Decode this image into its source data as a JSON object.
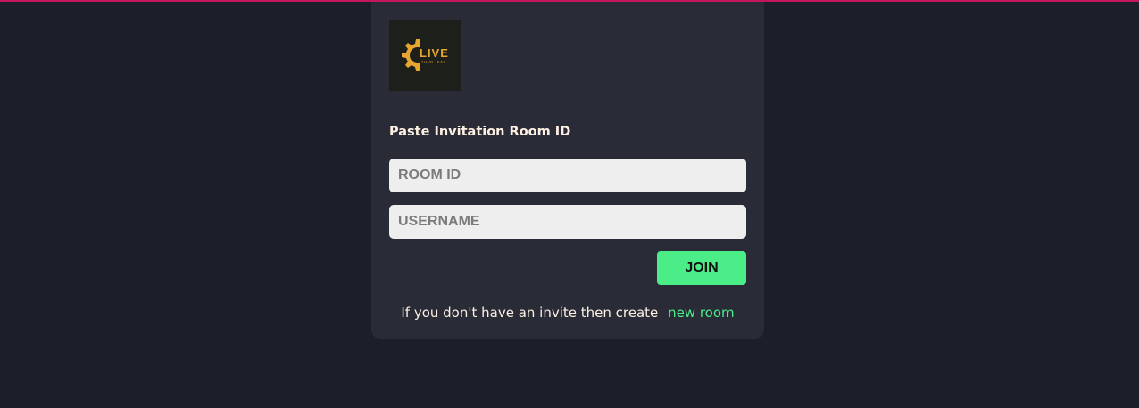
{
  "logo": {
    "text": "LIVE",
    "subtext": "YOUR TEXT",
    "icon": "gear-icon",
    "color": "#e8a530",
    "background": "#1d1f1b"
  },
  "form": {
    "heading": "Paste Invitation Room ID",
    "room_id_placeholder": "ROOM ID",
    "username_placeholder": "USERNAME",
    "join_label": "JOIN"
  },
  "footer": {
    "text": "If you don't have an invite then create",
    "link_label": "new room"
  },
  "colors": {
    "page_background": "#1c1e29",
    "card_background": "#292b37",
    "accent": "#4aed88",
    "top_border": "#c2185b",
    "text": "#fdf0e2"
  }
}
